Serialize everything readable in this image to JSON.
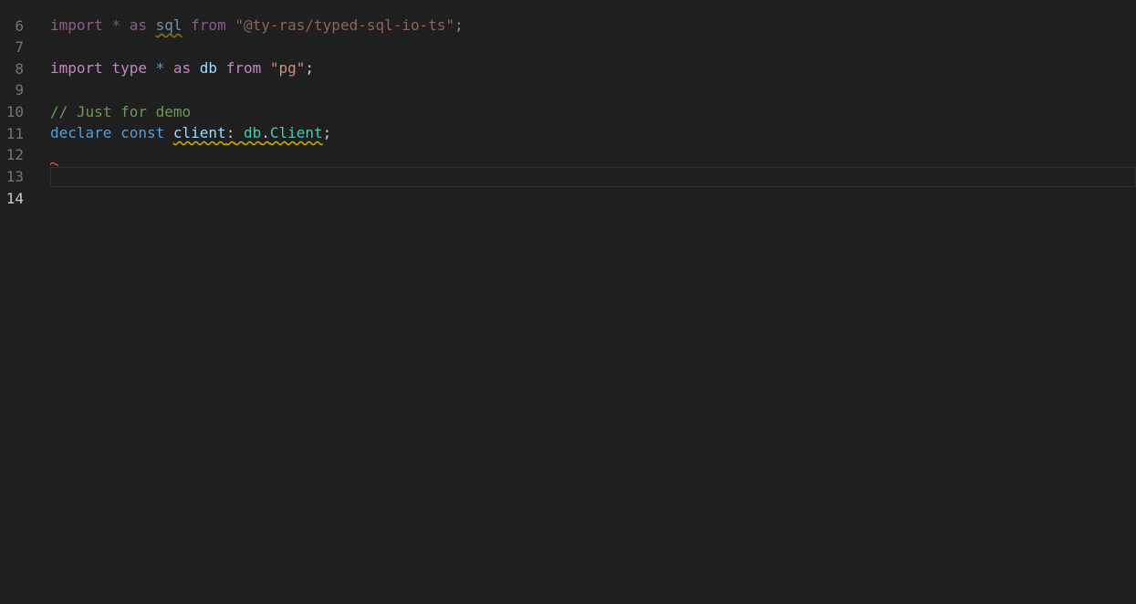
{
  "editor": {
    "lines": [
      {
        "number": "6"
      },
      {
        "number": "7"
      },
      {
        "number": "8"
      },
      {
        "number": "9"
      },
      {
        "number": "10"
      },
      {
        "number": "11"
      },
      {
        "number": "12"
      },
      {
        "number": "13"
      },
      {
        "number": "14"
      }
    ],
    "tokens": {
      "import": "import",
      "star": "*",
      "as": "as",
      "sql": "sql",
      "from": "from",
      "module1": "\"@ty-ras/typed-sql-io-ts\"",
      "semi": ";",
      "type": "type",
      "db": "db",
      "module2": "\"pg\"",
      "comment": "// Just for demo",
      "declare": "declare",
      "const": "const",
      "client": "client",
      "colon": ":",
      "dot": ".",
      "Client": "Client"
    },
    "colors": {
      "background": "#1f1f1f",
      "keyword_control": "#c586c0",
      "keyword": "#569cd6",
      "variable": "#9cdcfe",
      "string": "#ce9178",
      "type": "#4ec9b0",
      "comment": "#6a9955",
      "warning": "#cca700",
      "error": "#f14c4c"
    }
  }
}
